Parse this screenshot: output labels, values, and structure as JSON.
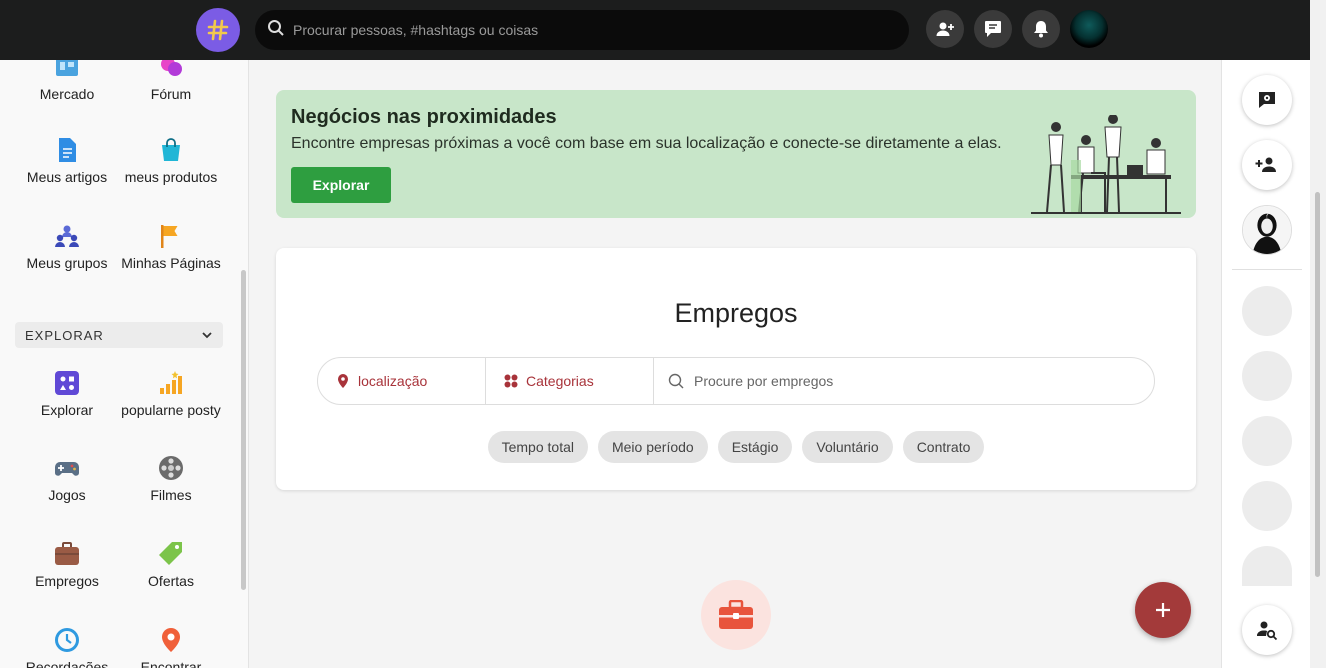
{
  "topbar": {
    "search_placeholder": "Procurar pessoas, #hashtags ou coisas",
    "icons": [
      "hashtag-logo-icon",
      "search-icon",
      "add-user-icon",
      "messages-icon",
      "bell-icon",
      "avatar"
    ]
  },
  "sidebar": {
    "items": [
      {
        "label": "Mercado",
        "icon": "market-icon"
      },
      {
        "label": "Fórum",
        "icon": "forum-icon"
      },
      {
        "label": "Meus artigos",
        "icon": "articles-icon"
      },
      {
        "label": "meus produtos",
        "icon": "products-icon"
      },
      {
        "label": "Meus grupos",
        "icon": "groups-icon"
      },
      {
        "label": "Minhas Páginas",
        "icon": "pages-icon"
      }
    ],
    "section_title": "EXPLORAR",
    "explore_items": [
      {
        "label": "Explorar",
        "icon": "explore-icon"
      },
      {
        "label": "popularne posty",
        "icon": "popular-posts-icon"
      },
      {
        "label": "Jogos",
        "icon": "gamepad-icon"
      },
      {
        "label": "Filmes",
        "icon": "film-reel-icon"
      },
      {
        "label": "Empregos",
        "icon": "briefcase-icon"
      },
      {
        "label": "Ofertas",
        "icon": "tag-icon"
      },
      {
        "label": "Recordações",
        "icon": "memories-icon"
      },
      {
        "label": "Encontrar",
        "icon": "location-icon"
      }
    ]
  },
  "banner": {
    "title": "Negócios nas proximidades",
    "text": "Encontre empresas próximas a você com base em sua localização e conecte-se diretamente a elas.",
    "button": "Explorar"
  },
  "jobs": {
    "title": "Empregos",
    "location": "localização",
    "categories": "Categorias",
    "search_placeholder": "Procure por empregos",
    "chips": [
      "Tempo total",
      "Meio período",
      "Estágio",
      "Voluntário",
      "Contrato"
    ]
  },
  "colors": {
    "topbar": "#1c1d1d",
    "logo": "#7b5ce5",
    "banner_bg": "#c8e6c9",
    "explore_button": "#2e9e40",
    "accent": "#a33a3a"
  }
}
